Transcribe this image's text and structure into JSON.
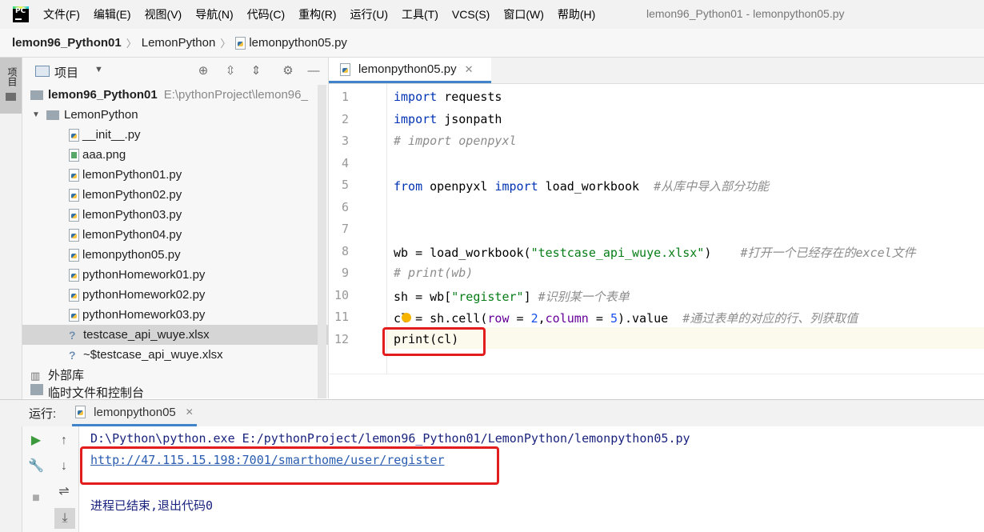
{
  "menubar": {
    "items": [
      "文件(F)",
      "编辑(E)",
      "视图(V)",
      "导航(N)",
      "代码(C)",
      "重构(R)",
      "运行(U)",
      "工具(T)",
      "VCS(S)",
      "窗口(W)",
      "帮助(H)"
    ],
    "window_title": "lemon96_Python01 - lemonpython05.py"
  },
  "breadcrumb": [
    "lemon96_Python01",
    "LemonPython",
    "lemonpython05.py"
  ],
  "left_stripe": {
    "project_label": "项目"
  },
  "project_panel": {
    "title": "项目",
    "root": {
      "name": "lemon96_Python01",
      "path": "E:\\pythonProject\\lemon96_"
    },
    "folder": "LemonPython",
    "files": [
      {
        "name": "__init__.py",
        "icon": "python-file-icon"
      },
      {
        "name": "aaa.png",
        "icon": "image-file-icon"
      },
      {
        "name": "lemonPython01.py",
        "icon": "python-file-icon"
      },
      {
        "name": "lemonPython02.py",
        "icon": "python-file-icon"
      },
      {
        "name": "lemonPython03.py",
        "icon": "python-file-icon"
      },
      {
        "name": "lemonPython04.py",
        "icon": "python-file-icon"
      },
      {
        "name": "lemonpython05.py",
        "icon": "python-file-icon"
      },
      {
        "name": "pythonHomework01.py",
        "icon": "python-file-icon"
      },
      {
        "name": "pythonHomework02.py",
        "icon": "python-file-icon"
      },
      {
        "name": "pythonHomework03.py",
        "icon": "python-file-icon"
      },
      {
        "name": "testcase_api_wuye.xlsx",
        "icon": "unknown-file-icon"
      },
      {
        "name": "~$testcase_api_wuye.xlsx",
        "icon": "unknown-file-icon"
      }
    ],
    "external_libs": "外部库",
    "scratches": "临时文件和控制台"
  },
  "editor": {
    "tab_label": "lemonpython05.py",
    "line_numbers": [
      "1",
      "2",
      "3",
      "4",
      "5",
      "6",
      "7",
      "8",
      "9",
      "10",
      "11",
      "12"
    ],
    "lines": {
      "l1": {
        "kw": "import",
        "rest": " requests"
      },
      "l2": {
        "kw": "import",
        "rest": " jsonpath"
      },
      "l3": {
        "comment": "# import openpyxl"
      },
      "l5": {
        "kw1": "from",
        "mid": " openpyxl ",
        "kw2": "import",
        "rest": " load_workbook  ",
        "comment": "#从库中导入部分功能"
      },
      "l8": {
        "pre": "wb = load_workbook(",
        "str": "\"testcase_api_wuye.xlsx\"",
        "post": ")    ",
        "comment": "#打开一个已经存在的excel文件"
      },
      "l9": {
        "comment": "# print(wb)"
      },
      "l10": {
        "pre": "sh = wb[",
        "str": "\"register\"",
        "post": "] ",
        "comment": "#识别某一个表单"
      },
      "l11": {
        "pre": "cl = sh.cell(",
        "p1": "row",
        "eq1": " = ",
        "n1": "2",
        "sep": ",",
        "p2": "column",
        "eq2": " = ",
        "n2": "5",
        "post": ").value  ",
        "comment": "#通过表单的对应的行、列获取值"
      },
      "l12": {
        "text": "print(cl)"
      }
    }
  },
  "run_panel": {
    "label": "运行:",
    "tab_label": "lemonpython05",
    "console": {
      "command": "D:\\Python\\python.exe E:/pythonProject/lemon96_Python01/LemonPython/lemonpython05.py",
      "link": "http://47.115.15.198:7001/smarthome/user/register",
      "exit": "进程已结束,退出代码0"
    }
  },
  "colors": {
    "highlight_box": "#e31d1d",
    "accent": "#4083c9"
  }
}
